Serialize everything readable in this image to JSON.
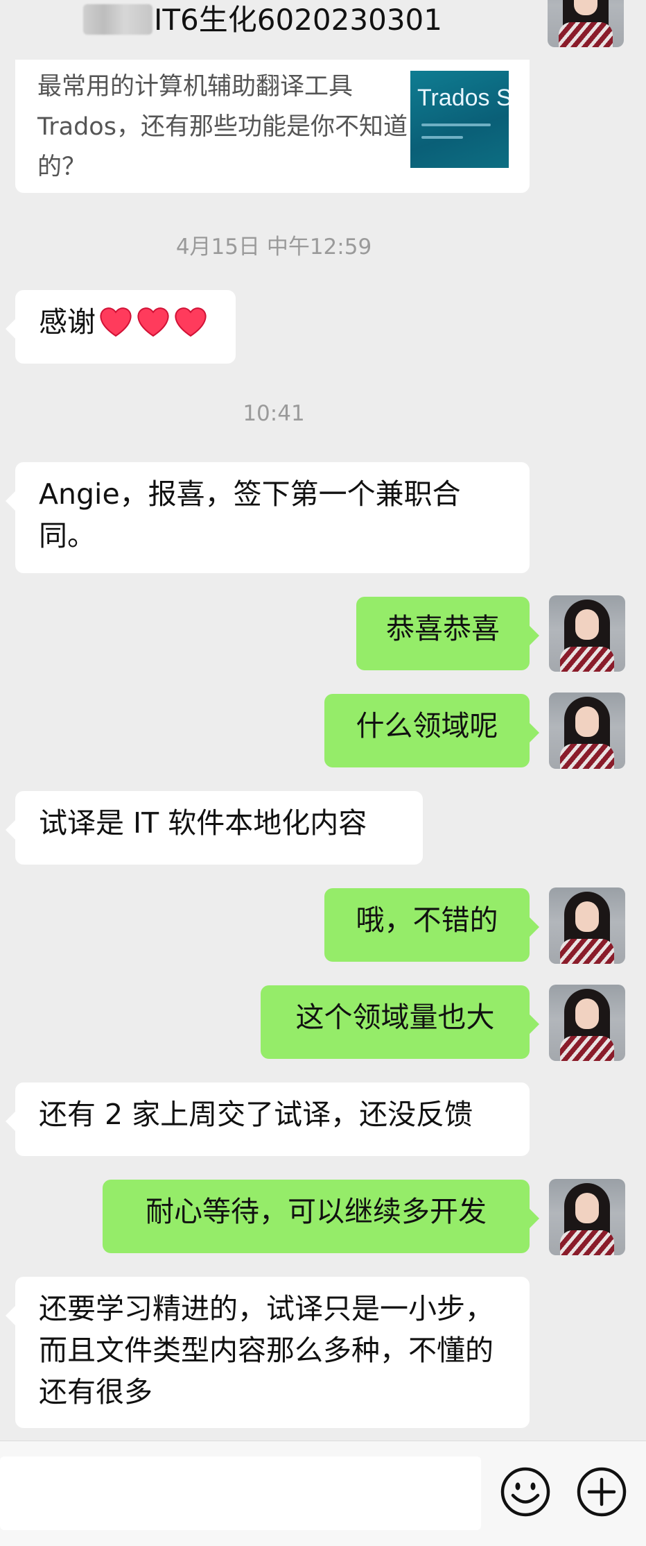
{
  "header": {
    "title": "IT6生化6020230301",
    "more_label": "···"
  },
  "link_card": {
    "text": "最常用的计算机辅助翻译工具Trados，还有那些功能是你不知道的？",
    "thumb_text": "Trados S"
  },
  "messages": [
    {
      "type": "timestamp",
      "text": "4月15日 中午12:59"
    },
    {
      "type": "received",
      "text": "感谢",
      "emoji": "❤❤❤"
    },
    {
      "type": "timestamp",
      "text": "10:41"
    },
    {
      "type": "received",
      "text": "Angie，报喜，签下第一个兼职合同。"
    },
    {
      "type": "sent",
      "text": "恭喜恭喜"
    },
    {
      "type": "sent",
      "text": "什么领域呢"
    },
    {
      "type": "received",
      "text": "试译是 IT 软件本地化内容"
    },
    {
      "type": "sent",
      "text": "哦，不错的"
    },
    {
      "type": "sent",
      "text": "这个领域量也大"
    },
    {
      "type": "received",
      "text": "还有 2 家上周交了试译，还没反馈"
    },
    {
      "type": "sent",
      "text": "耐心等待，可以继续多开发"
    },
    {
      "type": "received",
      "text": "还要学习精进的，试译只是一小步，而且文件类型内容那么多种，不懂的还有很多"
    }
  ],
  "input": {
    "value": "",
    "placeholder": ""
  },
  "icons": {
    "emoji": "emoji-icon",
    "plus": "plus-icon",
    "more": "more-icon"
  },
  "colors": {
    "background": "#ededed",
    "sent_bubble": "#95ec69",
    "received_bubble": "#ffffff",
    "timestamp": "#9a9a9a"
  }
}
